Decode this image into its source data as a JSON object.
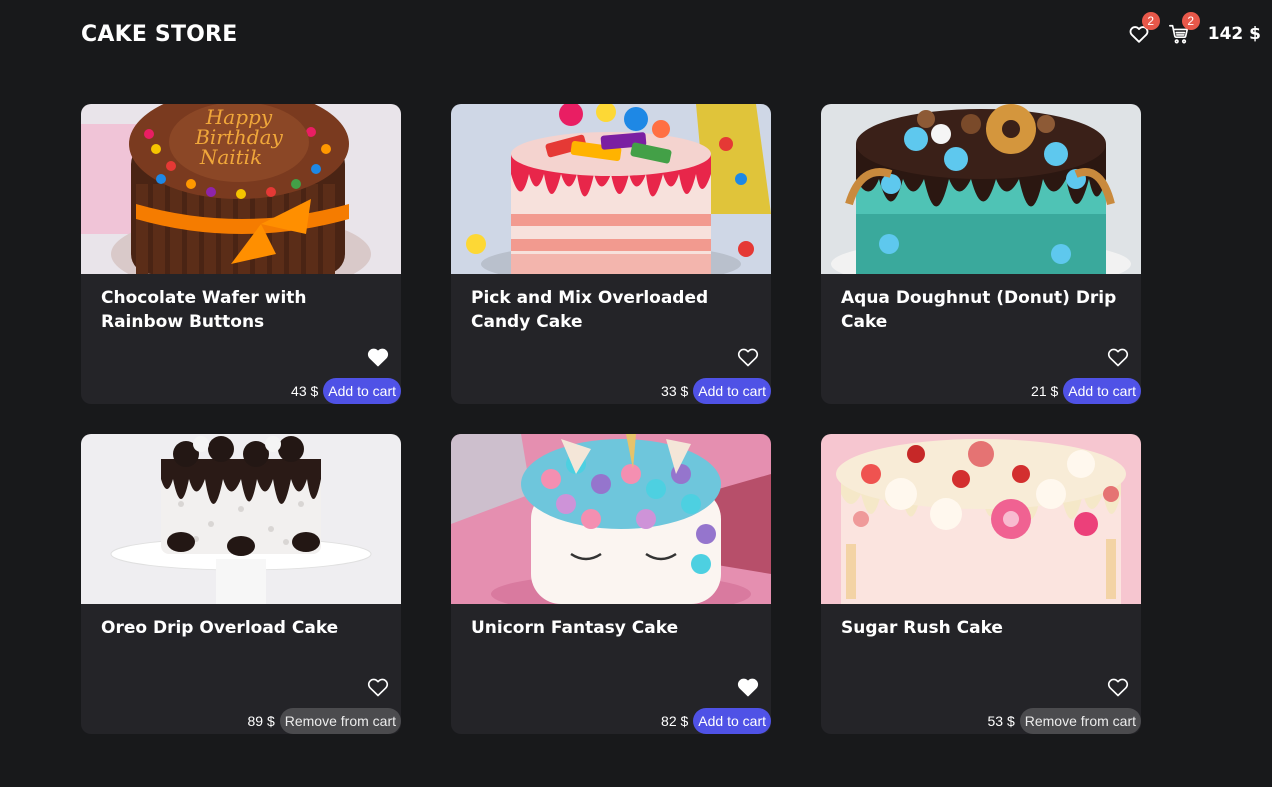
{
  "header": {
    "brand": "CAKE STORE",
    "wishlist_count": "2",
    "cart_count": "2",
    "total": "142 $"
  },
  "products": [
    {
      "title": "Chocolate Wafer with Rainbow Buttons",
      "price": "43 $",
      "button": "Add to cart",
      "in_cart": false,
      "favorited": true,
      "image": "chocolate-wafer-rainbow-cake"
    },
    {
      "title": "Pick and Mix Overloaded Candy Cake",
      "price": "33 $",
      "button": "Add to cart",
      "in_cart": false,
      "favorited": false,
      "image": "candy-overload-cake"
    },
    {
      "title": "Aqua Doughnut (Donut) Drip Cake",
      "price": "21 $",
      "button": "Add to cart",
      "in_cart": false,
      "favorited": false,
      "image": "aqua-donut-drip-cake"
    },
    {
      "title": "Oreo Drip Overload Cake",
      "price": "89 $",
      "button": "Remove from cart",
      "in_cart": true,
      "favorited": false,
      "image": "oreo-drip-cake"
    },
    {
      "title": "Unicorn Fantasy Cake",
      "price": "82 $",
      "button": "Add to cart",
      "in_cart": false,
      "favorited": true,
      "image": "unicorn-cake"
    },
    {
      "title": "Sugar Rush Cake",
      "price": "53 $",
      "button": "Remove from cart",
      "in_cart": true,
      "favorited": false,
      "image": "sugar-rush-cake"
    }
  ],
  "colors": {
    "background": "#18191b",
    "card": "#242428",
    "accent": "#4f52e6",
    "badge": "#e8584a",
    "remove_button": "#4b4b4e"
  }
}
